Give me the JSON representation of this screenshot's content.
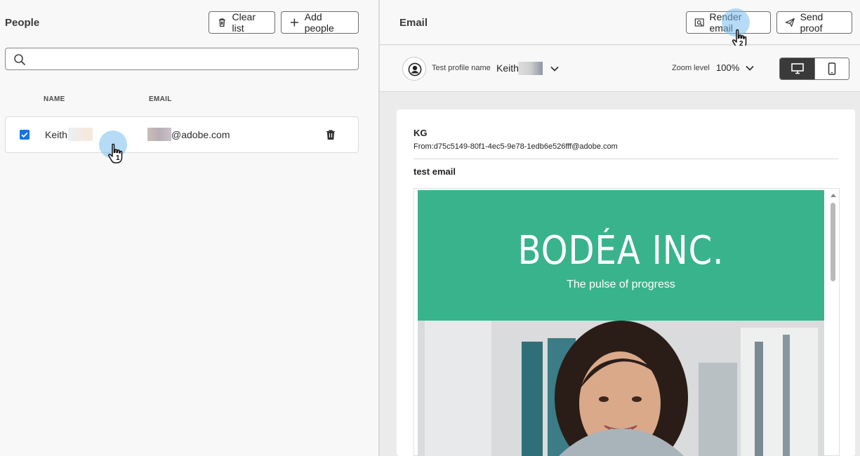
{
  "people": {
    "title": "People",
    "clear_label": "Clear list",
    "add_label": "Add people",
    "search_placeholder": "",
    "columns": {
      "name": "NAME",
      "email": "EMAIL"
    },
    "rows": [
      {
        "name": "Keith",
        "email": "@adobe.com",
        "checked": true
      }
    ]
  },
  "email": {
    "title": "Email",
    "render_label": "Render email",
    "send_label": "Send proof",
    "test_profile_label": "Test profile name",
    "test_profile_value": "Keith",
    "zoom_label": "Zoom level",
    "zoom_value": "100%",
    "preview": {
      "sender_initials": "KG",
      "from": "From:d75c5149-80f1-4ec5-9e78-1edb6e526fff@adobe.com",
      "subject": "test email",
      "brand": "BODÉA INC.",
      "tagline": "The pulse of progress"
    }
  },
  "markers": {
    "step1": "1",
    "step2": "2"
  },
  "colors": {
    "accent": "#1473e6",
    "brand_green": "#39b38b"
  }
}
